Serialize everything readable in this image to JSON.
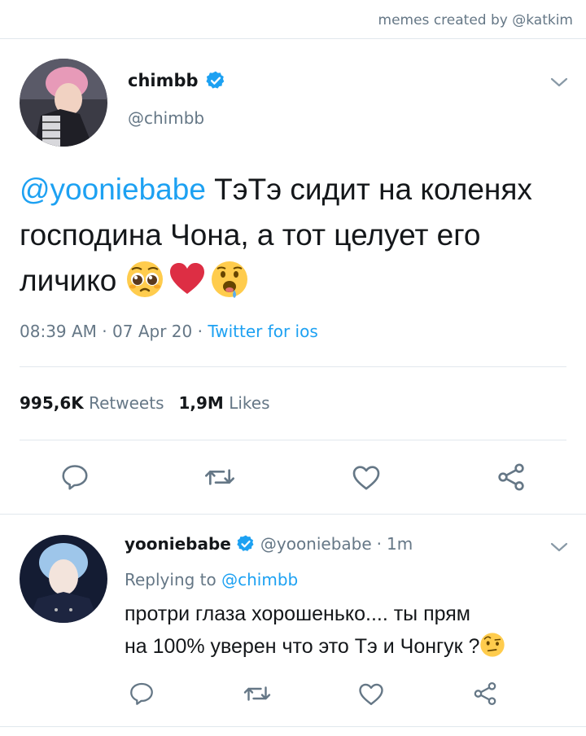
{
  "credit": "memes created by @katkim",
  "main_tweet": {
    "display_name": "chimbb",
    "handle": "@chimbb",
    "mention": "@yooniebabe",
    "text": " ТэТэ сидит на коленях господина Чона, а тот целует его личико ",
    "emojis": [
      "pleading-face",
      "red-heart",
      "drooling-face"
    ],
    "time": "08:39 AM",
    "date": "07 Apr 20",
    "source": "Twitter for ios",
    "retweets_count": "995,6K",
    "retweets_label": "Retweets",
    "likes_count": "1,9M",
    "likes_label": "Likes"
  },
  "reply_tweet": {
    "display_name": "yooniebabe",
    "handle": "@yooniebabe",
    "time_ago": "1m",
    "replying_prefix": "Replying to ",
    "replying_to": "@chimbb",
    "text_line1": "протри глаза хорошенько.... ты прям",
    "text_line2": "на 100% уверен что это Тэ и Чонгук ?",
    "emojis": [
      "face-with-raised-eyebrow"
    ]
  },
  "colors": {
    "accent": "#1da1f2",
    "secondary_text": "#657786",
    "divider": "#e1e8ed",
    "heart": "#e0245e"
  }
}
